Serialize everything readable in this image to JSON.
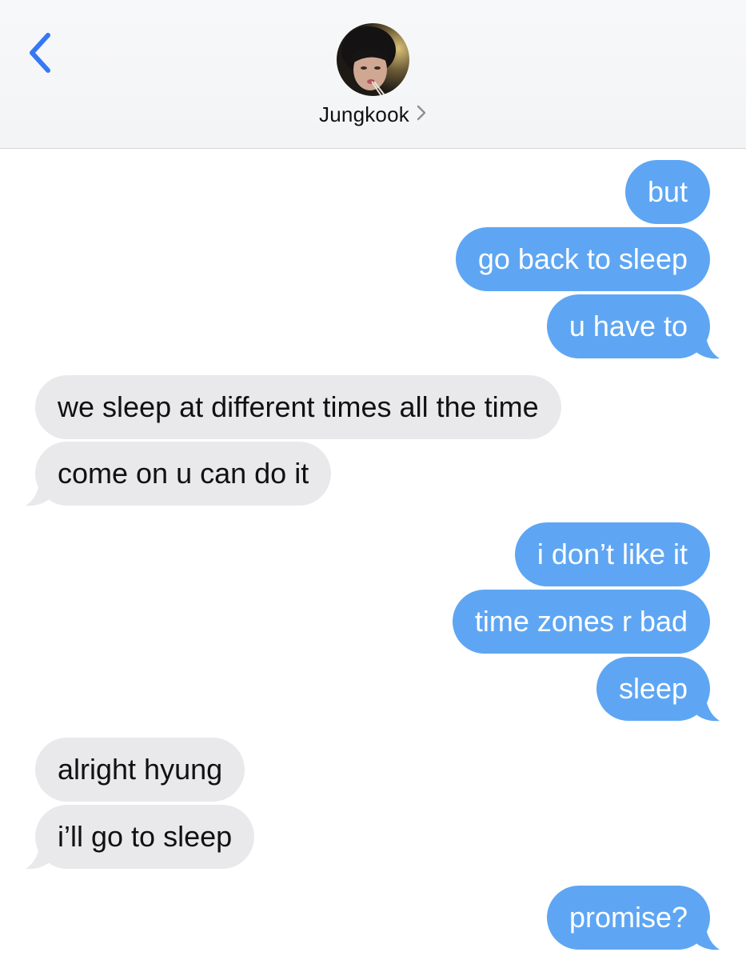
{
  "contact": {
    "name": "Jungkook",
    "chevron": "›"
  },
  "colors": {
    "outgoing_bubble": "#5ea6f3",
    "incoming_bubble": "#e9e9eb",
    "accent": "#3478f6"
  },
  "icons": {
    "back": "chevron-left-icon",
    "contact_details": "chevron-right-icon"
  },
  "messages": [
    {
      "direction": "outgoing",
      "text": "but"
    },
    {
      "direction": "outgoing",
      "text": "go back to sleep"
    },
    {
      "direction": "outgoing",
      "text": "u have to"
    },
    {
      "direction": "incoming",
      "text": "we sleep at different times all the time"
    },
    {
      "direction": "incoming",
      "text": "come on u can do it"
    },
    {
      "direction": "outgoing",
      "text": "i don’t like it"
    },
    {
      "direction": "outgoing",
      "text": "time zones r bad"
    },
    {
      "direction": "outgoing",
      "text": "sleep"
    },
    {
      "direction": "incoming",
      "text": "alright hyung"
    },
    {
      "direction": "incoming",
      "text": "i’ll go to sleep"
    },
    {
      "direction": "outgoing",
      "text": "promise?"
    }
  ]
}
